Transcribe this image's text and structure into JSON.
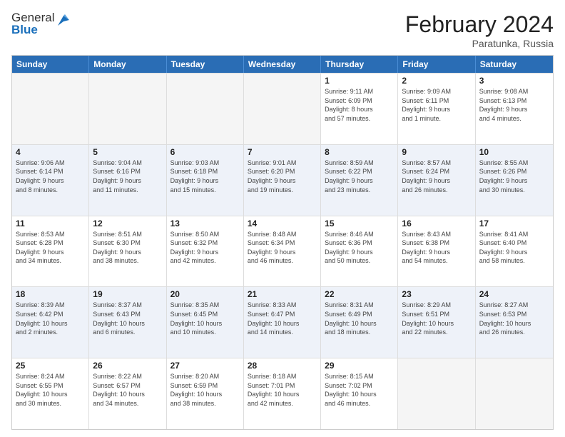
{
  "header": {
    "logo_general": "General",
    "logo_blue": "Blue",
    "title": "February 2024",
    "subtitle": "Paratunka, Russia"
  },
  "weekdays": [
    "Sunday",
    "Monday",
    "Tuesday",
    "Wednesday",
    "Thursday",
    "Friday",
    "Saturday"
  ],
  "rows": [
    [
      {
        "day": "",
        "info": ""
      },
      {
        "day": "",
        "info": ""
      },
      {
        "day": "",
        "info": ""
      },
      {
        "day": "",
        "info": ""
      },
      {
        "day": "1",
        "info": "Sunrise: 9:11 AM\nSunset: 6:09 PM\nDaylight: 8 hours\nand 57 minutes."
      },
      {
        "day": "2",
        "info": "Sunrise: 9:09 AM\nSunset: 6:11 PM\nDaylight: 9 hours\nand 1 minute."
      },
      {
        "day": "3",
        "info": "Sunrise: 9:08 AM\nSunset: 6:13 PM\nDaylight: 9 hours\nand 4 minutes."
      }
    ],
    [
      {
        "day": "4",
        "info": "Sunrise: 9:06 AM\nSunset: 6:14 PM\nDaylight: 9 hours\nand 8 minutes."
      },
      {
        "day": "5",
        "info": "Sunrise: 9:04 AM\nSunset: 6:16 PM\nDaylight: 9 hours\nand 11 minutes."
      },
      {
        "day": "6",
        "info": "Sunrise: 9:03 AM\nSunset: 6:18 PM\nDaylight: 9 hours\nand 15 minutes."
      },
      {
        "day": "7",
        "info": "Sunrise: 9:01 AM\nSunset: 6:20 PM\nDaylight: 9 hours\nand 19 minutes."
      },
      {
        "day": "8",
        "info": "Sunrise: 8:59 AM\nSunset: 6:22 PM\nDaylight: 9 hours\nand 23 minutes."
      },
      {
        "day": "9",
        "info": "Sunrise: 8:57 AM\nSunset: 6:24 PM\nDaylight: 9 hours\nand 26 minutes."
      },
      {
        "day": "10",
        "info": "Sunrise: 8:55 AM\nSunset: 6:26 PM\nDaylight: 9 hours\nand 30 minutes."
      }
    ],
    [
      {
        "day": "11",
        "info": "Sunrise: 8:53 AM\nSunset: 6:28 PM\nDaylight: 9 hours\nand 34 minutes."
      },
      {
        "day": "12",
        "info": "Sunrise: 8:51 AM\nSunset: 6:30 PM\nDaylight: 9 hours\nand 38 minutes."
      },
      {
        "day": "13",
        "info": "Sunrise: 8:50 AM\nSunset: 6:32 PM\nDaylight: 9 hours\nand 42 minutes."
      },
      {
        "day": "14",
        "info": "Sunrise: 8:48 AM\nSunset: 6:34 PM\nDaylight: 9 hours\nand 46 minutes."
      },
      {
        "day": "15",
        "info": "Sunrise: 8:46 AM\nSunset: 6:36 PM\nDaylight: 9 hours\nand 50 minutes."
      },
      {
        "day": "16",
        "info": "Sunrise: 8:43 AM\nSunset: 6:38 PM\nDaylight: 9 hours\nand 54 minutes."
      },
      {
        "day": "17",
        "info": "Sunrise: 8:41 AM\nSunset: 6:40 PM\nDaylight: 9 hours\nand 58 minutes."
      }
    ],
    [
      {
        "day": "18",
        "info": "Sunrise: 8:39 AM\nSunset: 6:42 PM\nDaylight: 10 hours\nand 2 minutes."
      },
      {
        "day": "19",
        "info": "Sunrise: 8:37 AM\nSunset: 6:43 PM\nDaylight: 10 hours\nand 6 minutes."
      },
      {
        "day": "20",
        "info": "Sunrise: 8:35 AM\nSunset: 6:45 PM\nDaylight: 10 hours\nand 10 minutes."
      },
      {
        "day": "21",
        "info": "Sunrise: 8:33 AM\nSunset: 6:47 PM\nDaylight: 10 hours\nand 14 minutes."
      },
      {
        "day": "22",
        "info": "Sunrise: 8:31 AM\nSunset: 6:49 PM\nDaylight: 10 hours\nand 18 minutes."
      },
      {
        "day": "23",
        "info": "Sunrise: 8:29 AM\nSunset: 6:51 PM\nDaylight: 10 hours\nand 22 minutes."
      },
      {
        "day": "24",
        "info": "Sunrise: 8:27 AM\nSunset: 6:53 PM\nDaylight: 10 hours\nand 26 minutes."
      }
    ],
    [
      {
        "day": "25",
        "info": "Sunrise: 8:24 AM\nSunset: 6:55 PM\nDaylight: 10 hours\nand 30 minutes."
      },
      {
        "day": "26",
        "info": "Sunrise: 8:22 AM\nSunset: 6:57 PM\nDaylight: 10 hours\nand 34 minutes."
      },
      {
        "day": "27",
        "info": "Sunrise: 8:20 AM\nSunset: 6:59 PM\nDaylight: 10 hours\nand 38 minutes."
      },
      {
        "day": "28",
        "info": "Sunrise: 8:18 AM\nSunset: 7:01 PM\nDaylight: 10 hours\nand 42 minutes."
      },
      {
        "day": "29",
        "info": "Sunrise: 8:15 AM\nSunset: 7:02 PM\nDaylight: 10 hours\nand 46 minutes."
      },
      {
        "day": "",
        "info": ""
      },
      {
        "day": "",
        "info": ""
      }
    ]
  ]
}
